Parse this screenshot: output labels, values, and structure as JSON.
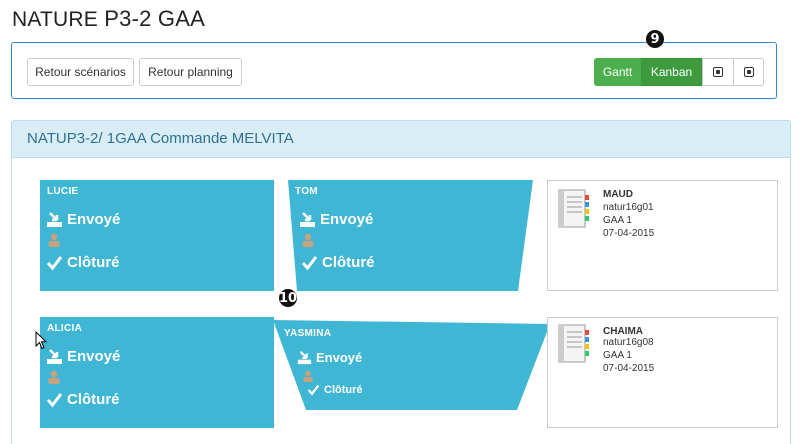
{
  "header": {
    "title_part1": "NATURE",
    "title_part2": " P3-2 GAA"
  },
  "toolbar": {
    "back_scenarios": "Retour scénarios",
    "back_planning": "Retour planning",
    "gantt": "Gantt",
    "kanban": "Kanban",
    "badge9": "9",
    "badge10": "10"
  },
  "panel": {
    "title": "NATUP3-2/ 1GAA Commande MELVITA"
  },
  "cards": [
    {
      "name": "LUCIE",
      "sent": "Envoyé",
      "closed": "Clôturé"
    },
    {
      "name": "TOM",
      "sent": "Envoyé",
      "closed": "Clôturé"
    },
    {
      "name": "ALICIA",
      "sent": "Envoyé",
      "closed": "Clôturé"
    },
    {
      "name": "YASMINA",
      "sent": "Envoyé",
      "closed": "Clôturé"
    }
  ],
  "members": [
    {
      "name": "MAUD",
      "code": "natur16g01",
      "group": "GAA 1",
      "date": "07-04-2015"
    },
    {
      "name": "CHAIMA",
      "code": "natur16g08",
      "group": "GAA 1",
      "date": "07-04-2015"
    }
  ],
  "colors": {
    "card": "#3fb7d4",
    "success": "#4cae4c",
    "panel_head": "#d9edf7"
  }
}
